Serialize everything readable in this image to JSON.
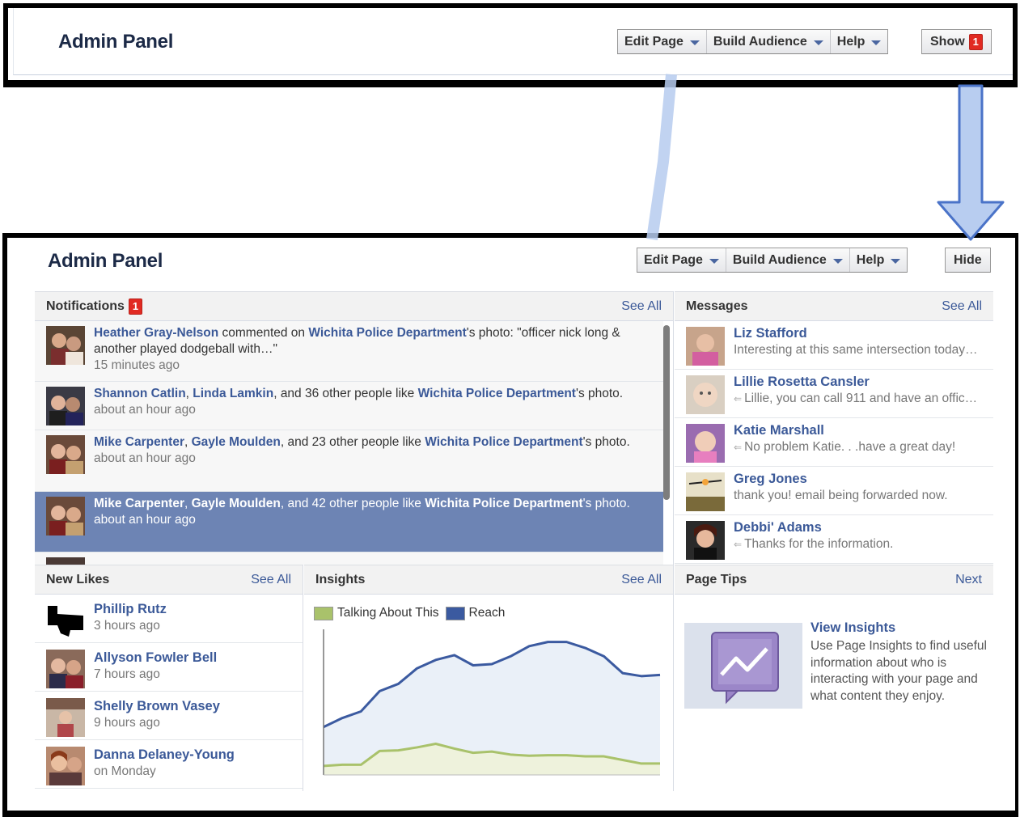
{
  "top_panel": {
    "title": "Admin Panel",
    "menu": {
      "edit_page": "Edit Page",
      "build_audience": "Build Audience",
      "help": "Help"
    },
    "show_label": "Show",
    "show_badge": "1"
  },
  "bottom_panel": {
    "title": "Admin Panel",
    "menu": {
      "edit_page": "Edit Page",
      "build_audience": "Build Audience",
      "help": "Help"
    },
    "hide_label": "Hide",
    "notifications": {
      "heading": "Notifications",
      "badge": "1",
      "see_all": "See All",
      "items": [
        {
          "actor": "Heather Gray-Nelson",
          "middle": " commented on ",
          "page": "Wichita Police Department",
          "rest": "'s photo: \"officer nick long & another played dodgeball with…\"",
          "time": "15 minutes ago"
        },
        {
          "actor": "Shannon Catlin",
          "sep": ", ",
          "actor2": "Linda Lamkin",
          "middle": ", and 36 other people like ",
          "page": "Wichita Police Department",
          "rest": "'s photo.",
          "time": "about an hour ago"
        },
        {
          "actor": "Mike Carpenter",
          "sep": ", ",
          "actor2": "Gayle Moulden",
          "middle": ", and 23 other people like ",
          "page": "Wichita Police Department",
          "rest": "'s photo.",
          "time": "about an hour ago"
        },
        {
          "actor": "Mike Carpenter",
          "sep": ", ",
          "actor2": "Gayle Moulden",
          "middle": ", and 42 other people like ",
          "page": "Wichita Police Department",
          "rest": "'s photo.",
          "time": "about an hour ago"
        }
      ]
    },
    "messages": {
      "heading": "Messages",
      "see_all": "See All",
      "items": [
        {
          "name": "Liz Stafford",
          "snippet": "Interesting at this same intersection today…",
          "replied": false
        },
        {
          "name": "Lillie Rosetta Cansler",
          "snippet": "Lillie, you can call 911 and have an offic…",
          "replied": true
        },
        {
          "name": "Katie Marshall",
          "snippet": "No problem Katie. . .have a great day!",
          "replied": true
        },
        {
          "name": "Greg Jones",
          "snippet": "thank you! email being forwarded now.",
          "replied": false
        },
        {
          "name": "Debbi' Adams",
          "snippet": "Thanks for the information.",
          "replied": true
        }
      ]
    },
    "new_likes": {
      "heading": "New Likes",
      "see_all": "See All",
      "items": [
        {
          "name": "Phillip Rutz",
          "time": "3 hours ago"
        },
        {
          "name": "Allyson Fowler Bell",
          "time": "7 hours ago"
        },
        {
          "name": "Shelly Brown Vasey",
          "time": "9 hours ago"
        },
        {
          "name": "Danna Delaney-Young",
          "time": "on Monday"
        }
      ]
    },
    "insights": {
      "heading": "Insights",
      "see_all": "See All"
    },
    "page_tips": {
      "heading": "Page Tips",
      "next": "Next",
      "tip_title": "View Insights",
      "tip_body": "Use Page Insights to find useful information about who is interacting with your page and what content they enjoy."
    }
  },
  "colors": {
    "link_blue": "#3b5998",
    "selected_row": "#6d84b4",
    "badge_red": "#e12a22",
    "talking_about_this": "#a9c26b",
    "reach": "#3b5aa0",
    "annotation_blue": "#b6cbee"
  },
  "chart_data": {
    "type": "area",
    "series": [
      {
        "name": "Talking About This",
        "values": [
          15,
          17,
          17,
          40,
          41,
          46,
          52,
          44,
          37,
          39,
          34,
          32,
          33,
          33,
          31,
          31,
          25,
          19,
          19
        ]
      },
      {
        "name": "Reach",
        "values": [
          80,
          95,
          106,
          140,
          152,
          178,
          192,
          200,
          183,
          185,
          198,
          215,
          222,
          222,
          212,
          198,
          170,
          165,
          167
        ]
      }
    ],
    "grid": false
  }
}
